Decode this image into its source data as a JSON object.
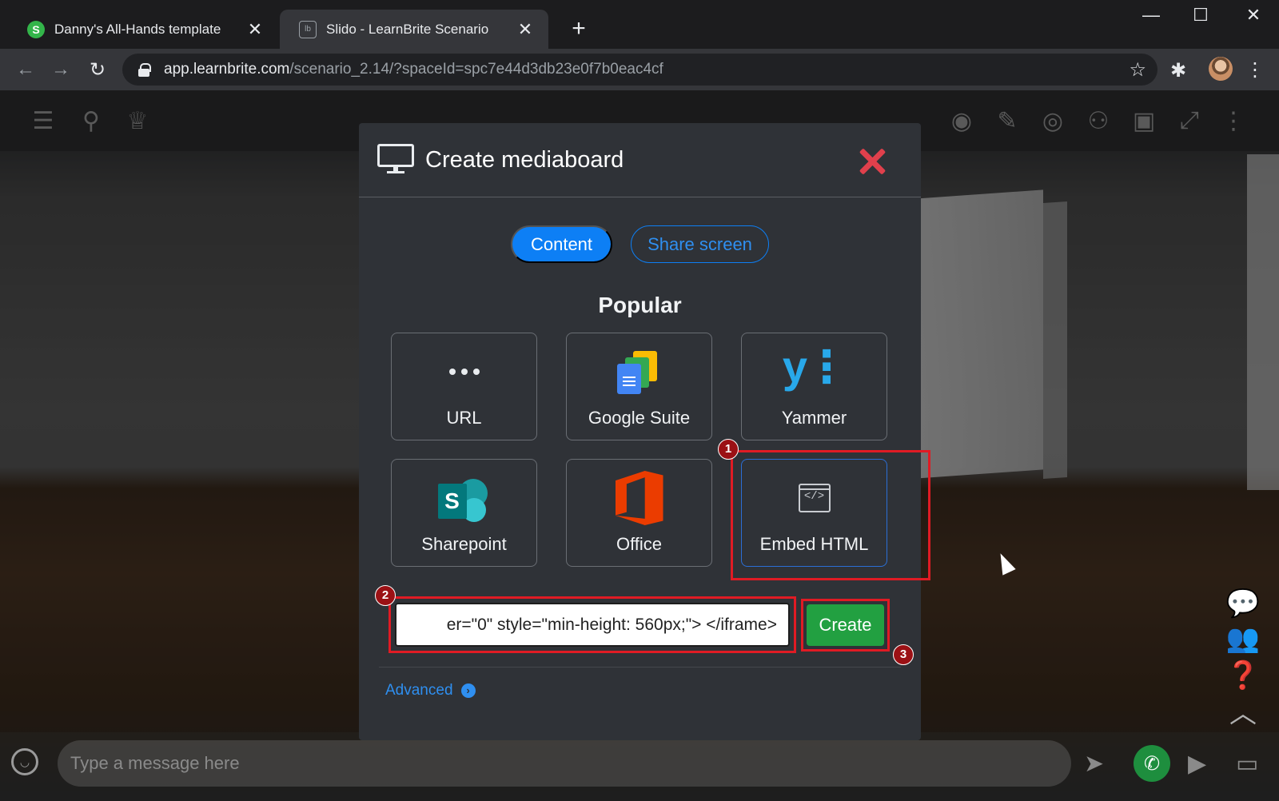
{
  "browser": {
    "tabs": [
      {
        "title": "Danny's All-Hands template",
        "favicon_letter": "S"
      },
      {
        "title": "Slido - LearnBrite Scenario",
        "favicon_letter": "lb"
      }
    ],
    "new_tab": "+",
    "url_host": "app.learnbrite.com",
    "url_path": "/scenario_2.14/?spaceId=spc7e44d3db23e0f7b0eac4cf",
    "window_controls": {
      "minimize": "—",
      "maximize": "☐",
      "close": "✕"
    }
  },
  "app": {
    "chat_placeholder": "Type a message here",
    "accent_call": "#1e8e3e"
  },
  "modal": {
    "title": "Create mediaboard",
    "tabs": {
      "content": "Content",
      "share_screen": "Share screen"
    },
    "section_title": "Popular",
    "tiles": [
      {
        "label": "URL",
        "icon": "dots-icon"
      },
      {
        "label": "Google Suite",
        "icon": "google-suite-icon"
      },
      {
        "label": "Yammer",
        "icon": "yammer-icon"
      },
      {
        "label": "Sharepoint",
        "icon": "sharepoint-icon"
      },
      {
        "label": "Office",
        "icon": "office-icon"
      },
      {
        "label": "Embed HTML",
        "icon": "embed-html-icon"
      }
    ],
    "yammer_glyph": "y⋮",
    "sharepoint_glyph": "S",
    "embed_glyph": "</>",
    "embed_input_value": "er=\"0\" style=\"min-height: 560px;\"> </iframe>",
    "create_label": "Create",
    "advanced_label": "Advanced",
    "advanced_chevron": "›",
    "colors": {
      "primary": "#0d7ff5",
      "success": "#22a041",
      "close": "#e0404c"
    }
  },
  "annotations": [
    {
      "number": "1"
    },
    {
      "number": "2"
    },
    {
      "number": "3"
    }
  ]
}
